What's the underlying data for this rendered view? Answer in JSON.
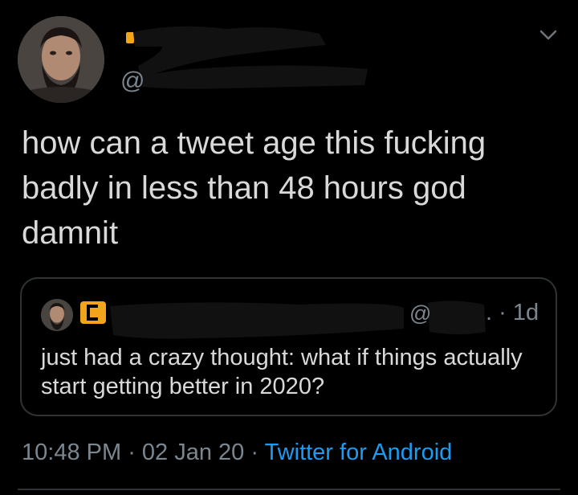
{
  "tweet": {
    "handle_prefix": "@",
    "text": "how can a tweet age this fucking badly in less than 48 hours god damnit"
  },
  "quoted_tweet": {
    "handle_prefix": "@",
    "meta": ". · 1d",
    "text": "just had a crazy thought: what if things actually start getting better in 2020?"
  },
  "footer": {
    "time": "10:48 PM",
    "sep1": " · ",
    "date": "02 Jan 20",
    "sep2": " · ",
    "source": "Twitter for Android"
  },
  "colors": {
    "background": "#000000",
    "text": "#d9d9d9",
    "muted": "#7b8790",
    "link": "#1d9bf0",
    "border": "#2f3336",
    "badge": "#f2a51a"
  },
  "icons": {
    "menu": "chevron-down-icon",
    "badge": "bracket-badge-icon"
  }
}
